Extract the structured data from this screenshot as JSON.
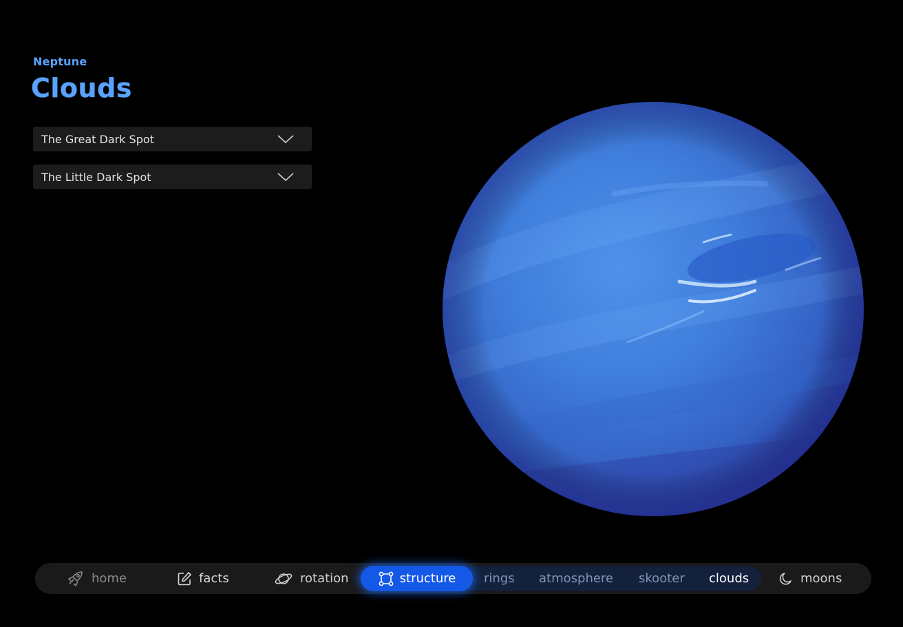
{
  "header": {
    "kicker": "Neptune",
    "title": "Clouds"
  },
  "accordions": [
    {
      "label": "The Great Dark Spot",
      "icon": "chevron-down-icon"
    },
    {
      "label": "The Little Dark Spot",
      "icon": "chevron-down-icon"
    }
  ],
  "planet": {
    "name": "Neptune",
    "colors": {
      "base": "#3f7fe0",
      "shadow": "#2e3fa6",
      "highlight": "#5a9cf0"
    }
  },
  "nav": {
    "items": [
      {
        "label": "home",
        "icon": "rocket-icon"
      },
      {
        "label": "facts",
        "icon": "edit-icon"
      },
      {
        "label": "rotation",
        "icon": "planet-icon"
      },
      {
        "label": "structure",
        "icon": "structure-icon",
        "active": true
      },
      {
        "label": "rings"
      },
      {
        "label": "atmosphere"
      },
      {
        "label": "skooter"
      },
      {
        "label": "clouds",
        "selected": true
      },
      {
        "label": "moons",
        "icon": "moon-icon"
      }
    ],
    "accent": "#1458e8"
  }
}
